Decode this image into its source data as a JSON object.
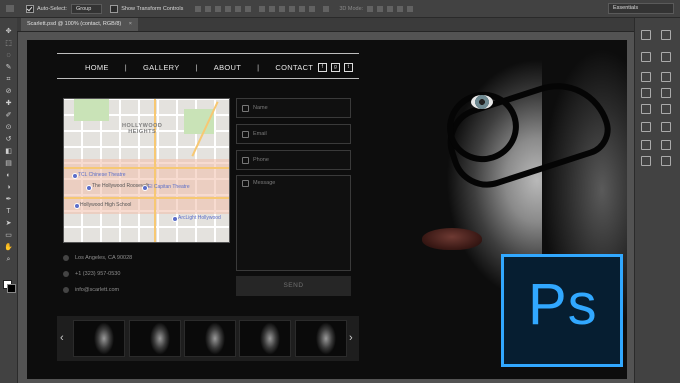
{
  "optionsbar": {
    "auto_select_label": "Auto-Select:",
    "auto_select_checked": true,
    "group_value": "Group",
    "show_transform_label": "Show Transform Controls",
    "mode_3d_label": "3D Mode:",
    "workspace": "Essentials"
  },
  "document": {
    "tab_title": "Scarlett.psd @ 100% (contact, RGB/8)",
    "close_glyph": "×"
  },
  "site": {
    "nav": [
      "HOME",
      "GALLERY",
      "ABOUT",
      "CONTACT"
    ],
    "nav_sep": "|",
    "social": [
      "f",
      "g",
      "t"
    ],
    "map": {
      "area_title": "HOLLYWOOD\nHEIGHTS",
      "labels": [
        "TCL Chinese Theatre",
        "The Hollywood Roosevelt",
        "El Capitan Theatre",
        "Hollywood High School",
        "ArcLight Hollywood"
      ]
    },
    "contact_info": {
      "address": "Los Angeles, CA 90028",
      "phone": "+1 (323) 957-0530",
      "email": "info@scarlett.com"
    },
    "form": {
      "name_placeholder": "Name",
      "email_placeholder": "Email",
      "phone_placeholder": "Phone",
      "message_placeholder": "Message",
      "send_label": "SEND"
    },
    "gallery_prev": "‹",
    "gallery_next": "›",
    "gallery_count": 5
  },
  "logo": {
    "text": "Ps",
    "border_color": "#31a8ff",
    "bg_color": "#061e31"
  },
  "icons": {
    "tools": [
      "move-icon",
      "marquee-icon",
      "lasso-icon",
      "quick-select-icon",
      "crop-icon",
      "eyedropper-icon",
      "healing-brush-icon",
      "brush-icon",
      "clone-stamp-icon",
      "history-brush-icon",
      "eraser-icon",
      "gradient-icon",
      "blur-icon",
      "dodge-icon",
      "pen-icon",
      "type-icon",
      "path-select-icon",
      "rectangle-icon",
      "hand-icon",
      "zoom-icon"
    ]
  }
}
